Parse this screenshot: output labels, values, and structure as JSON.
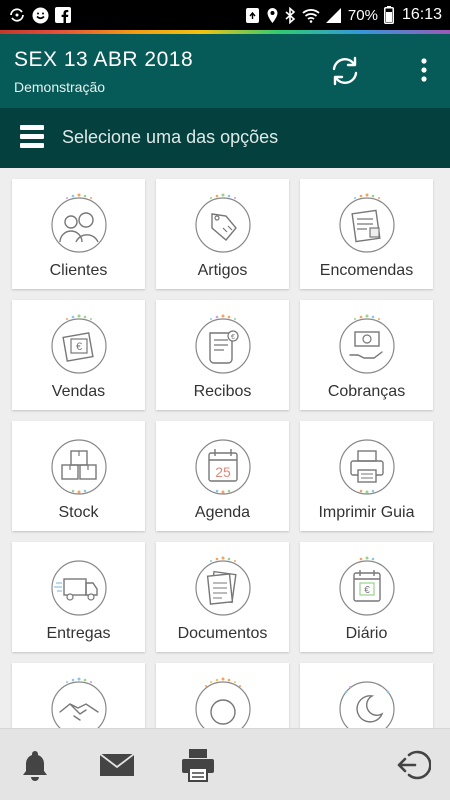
{
  "status_bar": {
    "battery": "70%",
    "time": "16:13",
    "icons": [
      "sync-icon",
      "smiley-icon",
      "facebook-icon",
      "recycle-icon",
      "location-icon",
      "bluetooth-icon",
      "wifi-icon",
      "signal-icon",
      "battery-icon"
    ]
  },
  "header": {
    "date": "SEX 13 ABR 2018",
    "subtitle": "Demonstração",
    "refresh_icon": "refresh-icon",
    "menu_icon": "more-vertical-icon"
  },
  "sub_header": {
    "title": "Selecione uma das opções",
    "menu_icon": "hamburger-icon"
  },
  "tiles": [
    {
      "label": "Clientes",
      "icon": "clients-icon"
    },
    {
      "label": "Artigos",
      "icon": "price-tag-icon"
    },
    {
      "label": "Encomendas",
      "icon": "order-sheet-icon"
    },
    {
      "label": "Vendas",
      "icon": "sales-receipt-icon"
    },
    {
      "label": "Recibos",
      "icon": "receipt-scroll-icon"
    },
    {
      "label": "Cobranças",
      "icon": "payment-hand-icon"
    },
    {
      "label": "Stock",
      "icon": "boxes-icon"
    },
    {
      "label": "Agenda",
      "icon": "calendar-icon"
    },
    {
      "label": "Imprimir Guia",
      "icon": "printer-icon"
    },
    {
      "label": "Entregas",
      "icon": "delivery-truck-icon"
    },
    {
      "label": "Documentos",
      "icon": "documents-icon"
    },
    {
      "label": "Diário",
      "icon": "journal-icon"
    },
    {
      "label": "",
      "icon": "handshake-icon"
    },
    {
      "label": "",
      "icon": "sun-icon"
    },
    {
      "label": "",
      "icon": "moon-icon"
    }
  ],
  "calendar_day": "25",
  "bottom_bar": {
    "icons": [
      "bell-icon",
      "mail-icon",
      "printer-icon",
      "logout-icon"
    ]
  },
  "colors": {
    "app_bar": "#065b58",
    "sub_bar": "#04403d",
    "background": "#eeeeee",
    "tile": "#ffffff",
    "icon_stroke": "#666666"
  }
}
